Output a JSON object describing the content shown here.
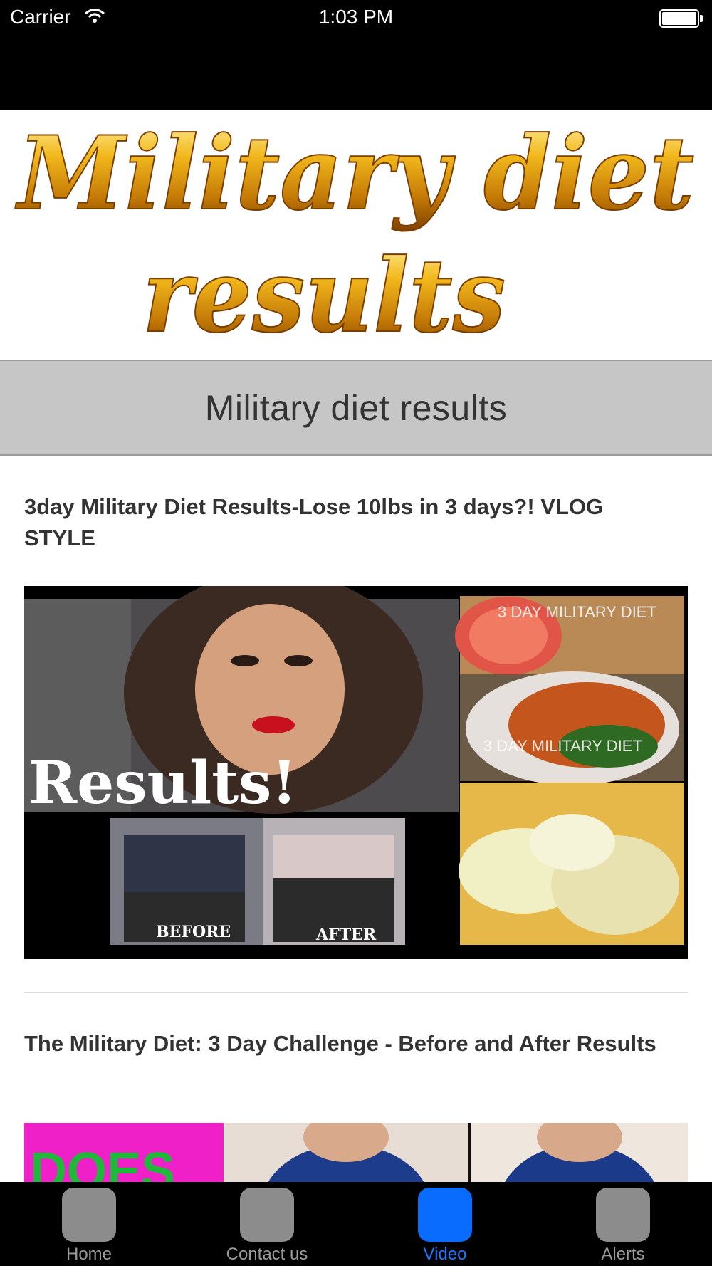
{
  "status_bar": {
    "carrier": "Carrier",
    "time": "1:03 PM"
  },
  "banner": {
    "line1": "Military diet",
    "line2": "results"
  },
  "header": {
    "title": "Military diet results"
  },
  "videos": [
    {
      "title": "3day Military Diet Results-Lose 10lbs in 3 days?! VLOG STYLE",
      "thumbnail_texts": {
        "results": "Results!",
        "before": "BEFORE",
        "after": "AFTER",
        "overlay_top": "3 DAY MILITARY DIET",
        "overlay_mid": "3 DAY MILITARY DIET"
      }
    },
    {
      "title": "The Military Diet: 3 Day Challenge - Before and After Results",
      "thumbnail_texts": {
        "partial": "DOES"
      }
    }
  ],
  "tab_bar": {
    "tabs": [
      {
        "label": "Home"
      },
      {
        "label": "Contact us"
      },
      {
        "label": "Video"
      },
      {
        "label": "Alerts"
      }
    ],
    "active_index": 2,
    "active_color": "#0a6cff",
    "inactive_color": "#8c8c8c"
  }
}
